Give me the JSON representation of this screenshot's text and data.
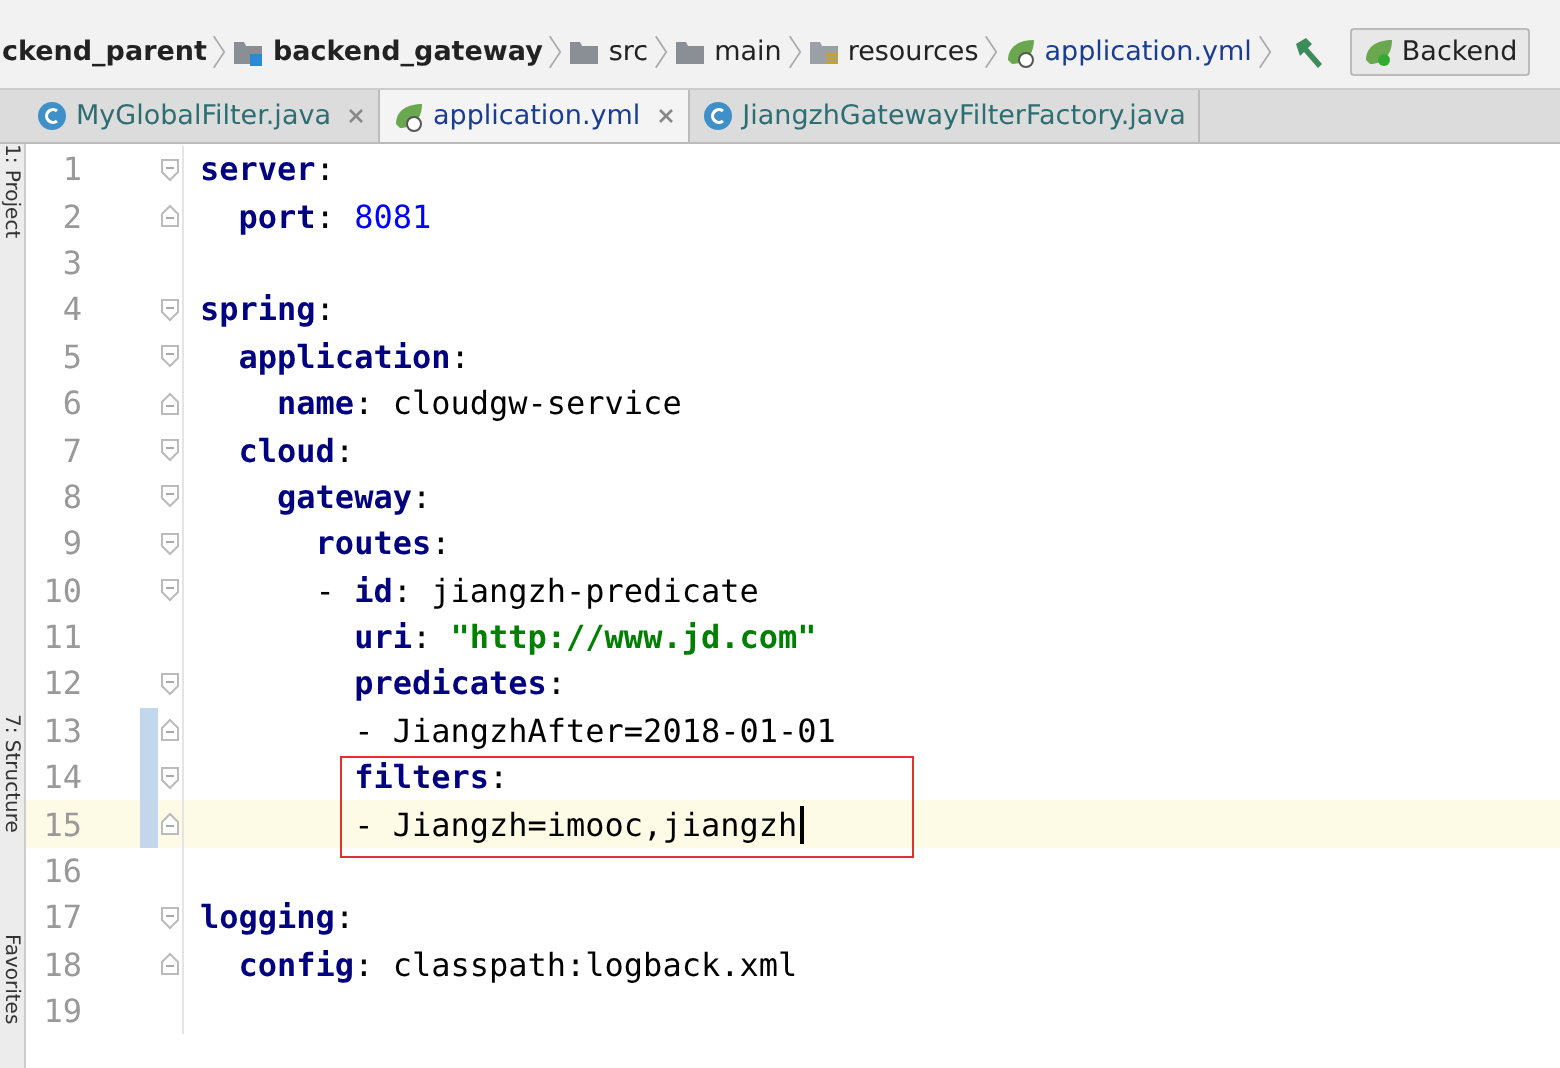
{
  "side_tools": [
    {
      "label": "1: Project"
    },
    {
      "label": "7: Structure"
    },
    {
      "label": "Favorites"
    }
  ],
  "breadcrumbs": [
    {
      "label": "ckend_parent",
      "kind": "module-root"
    },
    {
      "label": "backend_gateway",
      "kind": "module"
    },
    {
      "label": "src",
      "kind": "folder"
    },
    {
      "label": "main",
      "kind": "folder"
    },
    {
      "label": "resources",
      "kind": "resources"
    },
    {
      "label": "application.yml",
      "kind": "yml"
    }
  ],
  "run_config": {
    "label": "Backend"
  },
  "tabs": [
    {
      "label": "MyGlobalFilter.java",
      "kind": "java",
      "selected": false,
      "closable": true
    },
    {
      "label": "application.yml",
      "kind": "yml",
      "selected": true,
      "closable": true
    },
    {
      "label": "JiangzhGatewayFilterFactory.java",
      "kind": "java",
      "selected": false,
      "closable": false
    }
  ],
  "lines": [
    {
      "number": "1",
      "fold_start": true,
      "fold_end": false,
      "changed": false,
      "current": false,
      "boxed": false,
      "tokens": [
        {
          "kind": "key",
          "text": "server"
        },
        {
          "kind": "punct",
          "text": ":"
        }
      ]
    },
    {
      "number": "2",
      "fold_start": false,
      "fold_end": true,
      "changed": false,
      "current": false,
      "boxed": false,
      "tokens": [
        {
          "kind": "key",
          "text": "  port"
        },
        {
          "kind": "punct",
          "text": ": "
        },
        {
          "kind": "number",
          "text": "8081"
        }
      ]
    },
    {
      "number": "3",
      "fold_start": false,
      "fold_end": false,
      "changed": false,
      "current": false,
      "boxed": false
    },
    {
      "number": "4",
      "fold_start": true,
      "fold_end": false,
      "changed": false,
      "current": false,
      "boxed": false,
      "tokens": [
        {
          "kind": "key",
          "text": "spring"
        },
        {
          "kind": "punct",
          "text": ":"
        }
      ]
    },
    {
      "number": "5",
      "fold_start": true,
      "fold_end": false,
      "changed": false,
      "current": false,
      "boxed": false,
      "tokens": [
        {
          "kind": "key",
          "text": "  application"
        },
        {
          "kind": "punct",
          "text": ":"
        }
      ]
    },
    {
      "number": "6",
      "fold_start": false,
      "fold_end": true,
      "changed": false,
      "current": false,
      "boxed": false,
      "tokens": [
        {
          "kind": "key",
          "text": "    name"
        },
        {
          "kind": "punct",
          "text": ": "
        },
        {
          "kind": "text",
          "text": "cloudgw-service"
        }
      ]
    },
    {
      "number": "7",
      "fold_start": true,
      "fold_end": false,
      "changed": false,
      "current": false,
      "boxed": false,
      "tokens": [
        {
          "kind": "key",
          "text": "  cloud"
        },
        {
          "kind": "punct",
          "text": ":"
        }
      ]
    },
    {
      "number": "8",
      "fold_start": true,
      "fold_end": false,
      "changed": false,
      "current": false,
      "boxed": false,
      "tokens": [
        {
          "kind": "key",
          "text": "    gateway"
        },
        {
          "kind": "punct",
          "text": ":"
        }
      ]
    },
    {
      "number": "9",
      "fold_start": true,
      "fold_end": false,
      "changed": false,
      "current": false,
      "boxed": false,
      "tokens": [
        {
          "kind": "key",
          "text": "      routes"
        },
        {
          "kind": "punct",
          "text": ":"
        }
      ]
    },
    {
      "number": "10",
      "fold_start": true,
      "fold_end": false,
      "changed": false,
      "current": false,
      "boxed": false,
      "tokens": [
        {
          "kind": "punct",
          "text": "      - "
        },
        {
          "kind": "key",
          "text": "id"
        },
        {
          "kind": "punct",
          "text": ": "
        },
        {
          "kind": "text",
          "text": "jiangzh-predicate"
        }
      ]
    },
    {
      "number": "11",
      "fold_start": false,
      "fold_end": false,
      "changed": false,
      "current": false,
      "boxed": false,
      "tokens": [
        {
          "kind": "key",
          "text": "        uri"
        },
        {
          "kind": "punct",
          "text": ": "
        },
        {
          "kind": "string",
          "text": "\"http://www.jd.com\""
        }
      ]
    },
    {
      "number": "12",
      "fold_start": true,
      "fold_end": false,
      "changed": false,
      "current": false,
      "boxed": false,
      "tokens": [
        {
          "kind": "key",
          "text": "        predicates"
        },
        {
          "kind": "punct",
          "text": ":"
        }
      ]
    },
    {
      "number": "13",
      "fold_start": false,
      "fold_end": true,
      "changed": true,
      "current": false,
      "boxed": false,
      "tokens": [
        {
          "kind": "text",
          "text": "        - JiangzhAfter=2018-01-01"
        }
      ]
    },
    {
      "number": "14",
      "fold_start": true,
      "fold_end": false,
      "changed": true,
      "current": false,
      "boxed": true,
      "tokens": [
        {
          "kind": "key",
          "text": "        filters"
        },
        {
          "kind": "punct",
          "text": ":"
        }
      ]
    },
    {
      "number": "15",
      "fold_start": false,
      "fold_end": true,
      "changed": true,
      "current": true,
      "boxed": true,
      "tokens": [
        {
          "kind": "text",
          "text": "        - Jiangzh=imooc,jiangzh"
        }
      ]
    },
    {
      "number": "16",
      "fold_start": false,
      "fold_end": false,
      "changed": false,
      "current": false,
      "boxed": false
    },
    {
      "number": "17",
      "fold_start": true,
      "fold_end": false,
      "changed": false,
      "current": false,
      "boxed": false,
      "tokens": [
        {
          "kind": "key",
          "text": "logging"
        },
        {
          "kind": "punct",
          "text": ":"
        }
      ]
    },
    {
      "number": "18",
      "fold_start": false,
      "fold_end": true,
      "changed": false,
      "current": false,
      "boxed": false,
      "tokens": [
        {
          "kind": "key",
          "text": "  config"
        },
        {
          "kind": "punct",
          "text": ": "
        },
        {
          "kind": "text",
          "text": "classpath:logback.xml"
        }
      ]
    },
    {
      "number": "19",
      "fold_start": false,
      "fold_end": false,
      "changed": false,
      "current": false,
      "boxed": false
    }
  ]
}
